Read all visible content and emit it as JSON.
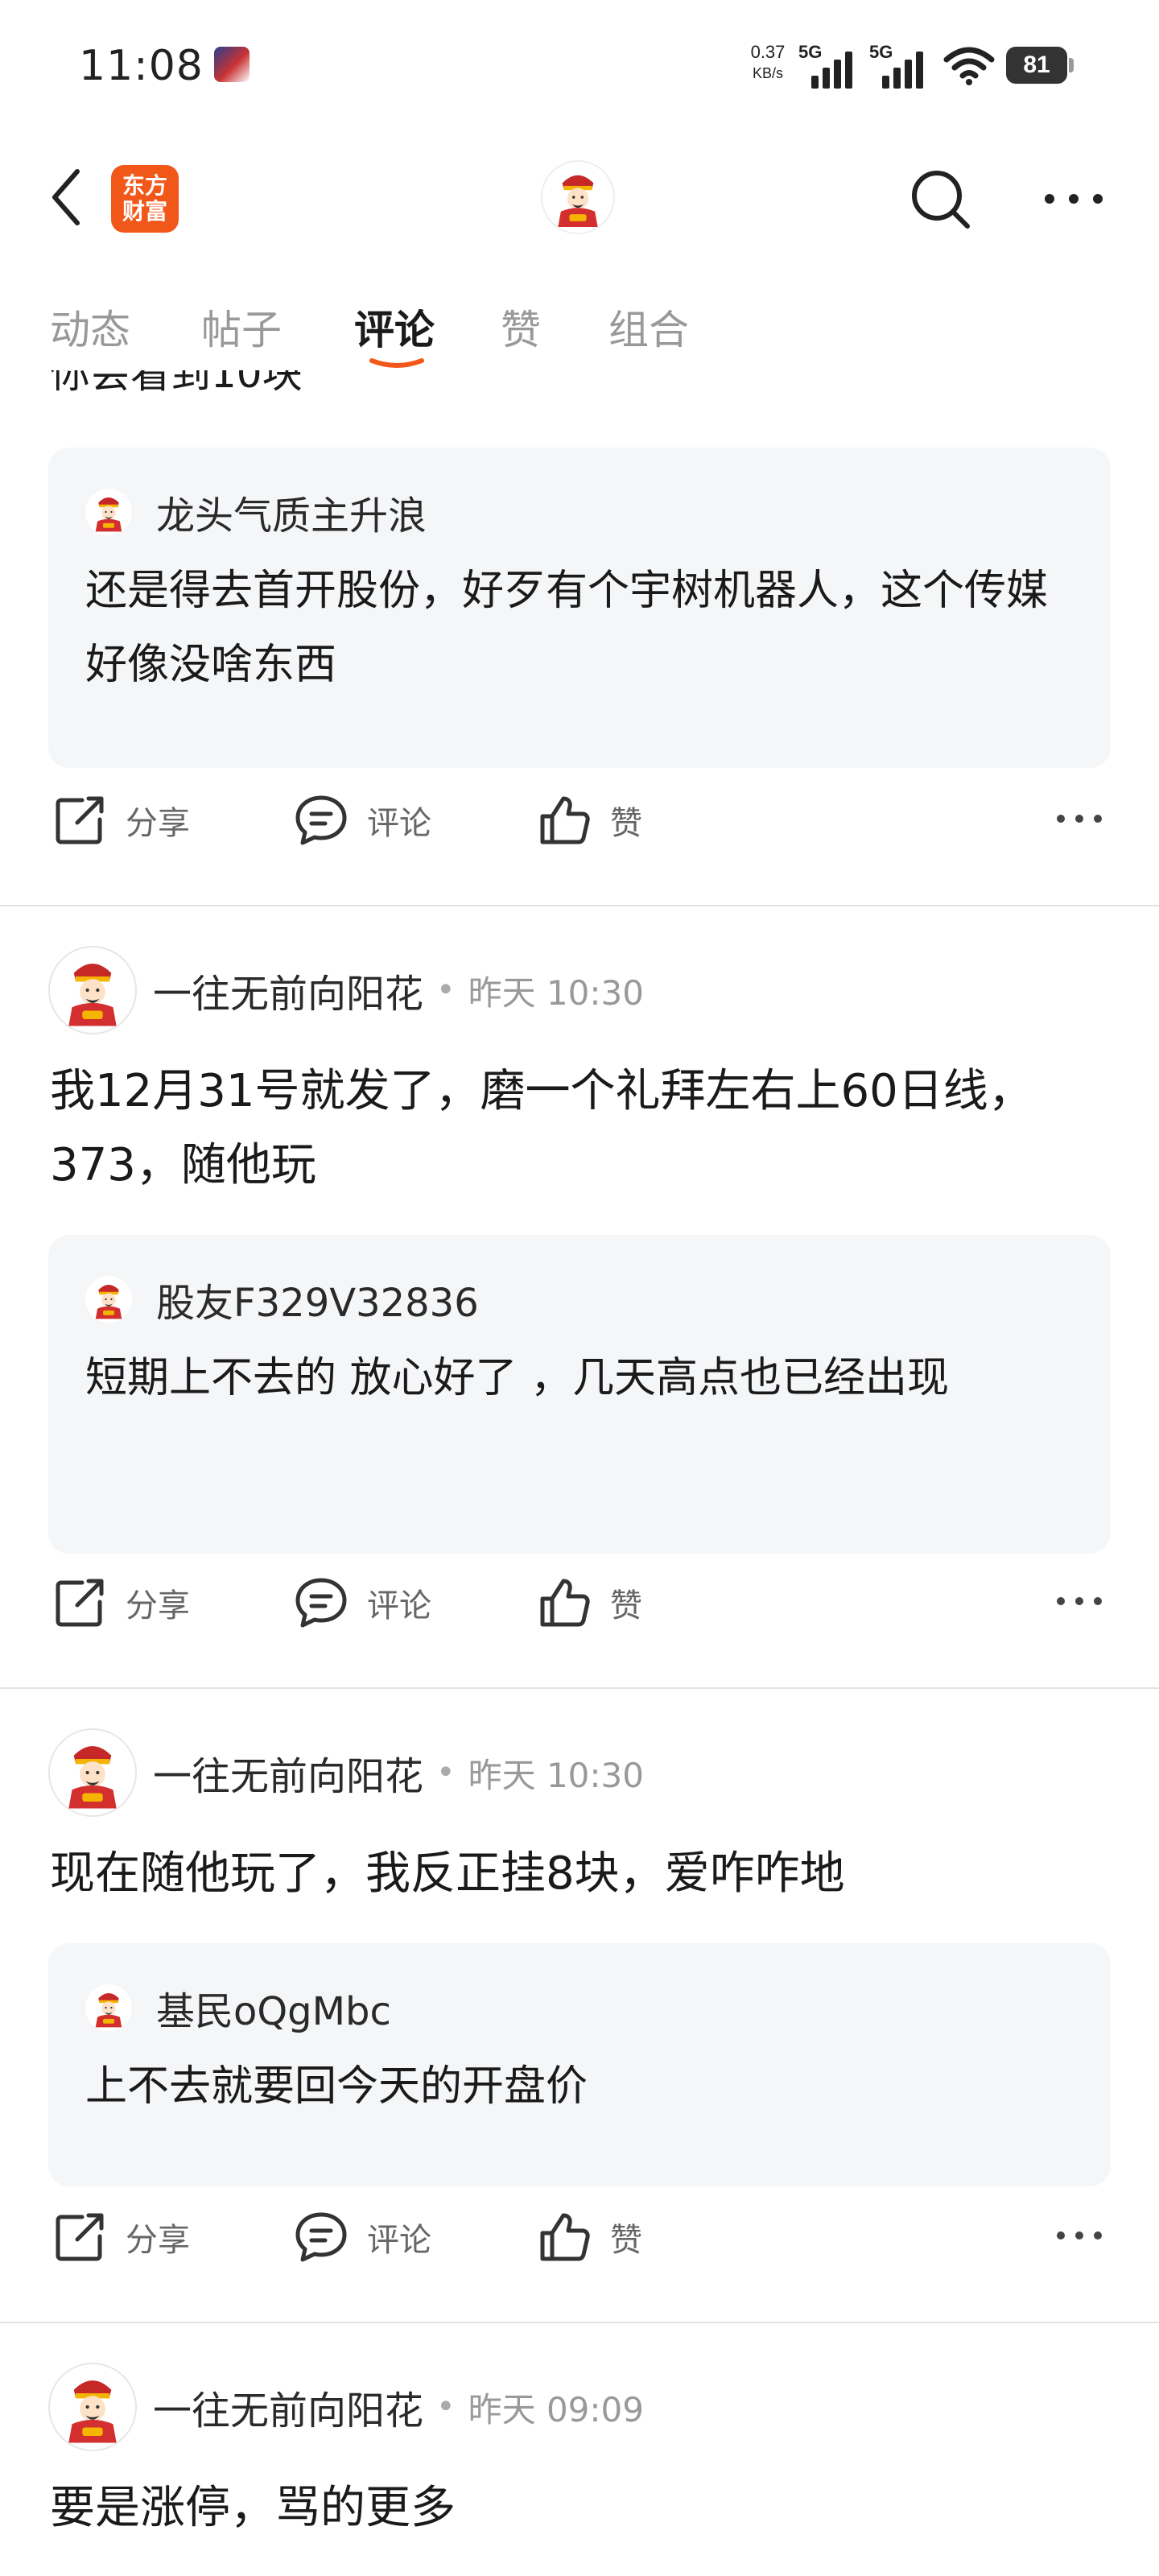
{
  "status_bar": {
    "time": "11:08",
    "net_speed_value": "0.37",
    "net_speed_unit": "KB/s",
    "sim1": "5G",
    "sim2": "5G",
    "battery": "81"
  },
  "header": {
    "brand_line1": "东方",
    "brand_line2": "财富",
    "brand_color": "#f2571a"
  },
  "tabs": [
    {
      "label": "动态",
      "active": false
    },
    {
      "label": "帖子",
      "active": false
    },
    {
      "label": "评论",
      "active": true
    },
    {
      "label": "赞",
      "active": false
    },
    {
      "label": "组合",
      "active": false
    }
  ],
  "accent_color": "#f2571a",
  "partial_text": "你会看到10块",
  "actions": {
    "share": "分享",
    "comment": "评论",
    "like": "赞"
  },
  "posts": [
    {
      "quote": {
        "user": "龙头气质主升浪",
        "text": "还是得去首开股份，好歹有个宇树机器人，这个传媒好像没啥东西"
      }
    },
    {
      "author": "一往无前向阳花",
      "dot": "•",
      "time": "昨天 10:30",
      "text": "我12月31号就发了，磨一个礼拜左右上60日线，373，随他玩",
      "quote": {
        "user": "股友F329V32836",
        "text": "短期上不去的 放心好了 ，几天高点也已经出现"
      }
    },
    {
      "author": "一往无前向阳花",
      "dot": "•",
      "time": "昨天 10:30",
      "text": "现在随他玩了，我反正挂8块，爱咋咋地",
      "quote": {
        "user": "基民oQgMbc",
        "text": "上不去就要回今天的开盘价"
      }
    },
    {
      "author": "一往无前向阳花",
      "dot": "•",
      "time": "昨天 09:09",
      "text": "要是涨停，骂的更多"
    }
  ]
}
